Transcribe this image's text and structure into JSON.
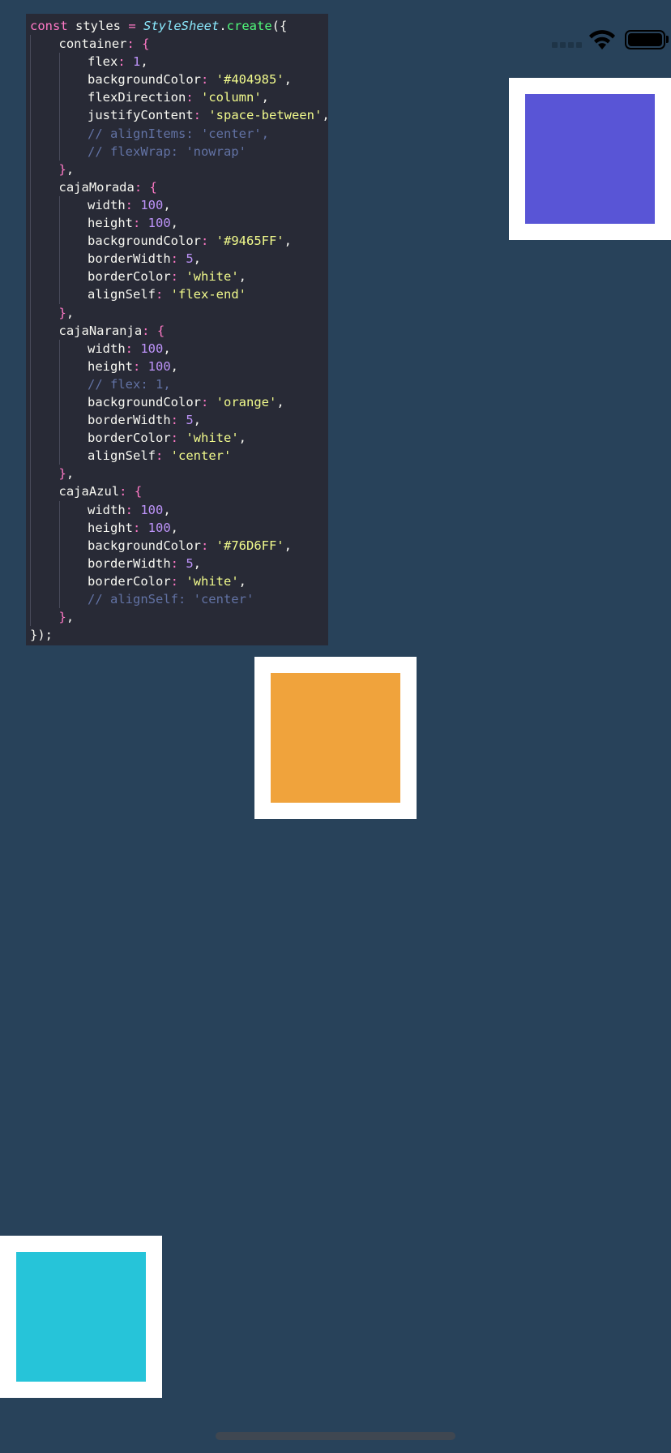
{
  "status_bar": {
    "signal_icon": "cellular-signal-icon",
    "wifi_icon": "wifi-icon",
    "battery_icon": "battery-icon"
  },
  "code": {
    "lines": [
      {
        "indent": 0,
        "tokens": [
          {
            "t": "const ",
            "c": "kw"
          },
          {
            "t": "styles ",
            "c": "ident"
          },
          {
            "t": "= ",
            "c": "op"
          },
          {
            "t": "StyleSheet",
            "c": "cls"
          },
          {
            "t": ".",
            "c": "ident"
          },
          {
            "t": "create",
            "c": "fn"
          },
          {
            "t": "({",
            "c": "ident"
          }
        ]
      },
      {
        "indent": 1,
        "tokens": [
          {
            "t": "container",
            "c": "ident"
          },
          {
            "t": ": ",
            "c": "op"
          },
          {
            "t": "{",
            "c": "br"
          }
        ]
      },
      {
        "indent": 2,
        "tokens": [
          {
            "t": "flex",
            "c": "ident"
          },
          {
            "t": ": ",
            "c": "op"
          },
          {
            "t": "1",
            "c": "nm"
          },
          {
            "t": ",",
            "c": "ident"
          }
        ]
      },
      {
        "indent": 2,
        "tokens": [
          {
            "t": "backgroundColor",
            "c": "ident"
          },
          {
            "t": ": ",
            "c": "op"
          },
          {
            "t": "'#404985'",
            "c": "str"
          },
          {
            "t": ",",
            "c": "ident"
          }
        ]
      },
      {
        "indent": 2,
        "tokens": [
          {
            "t": "flexDirection",
            "c": "ident"
          },
          {
            "t": ": ",
            "c": "op"
          },
          {
            "t": "'column'",
            "c": "str"
          },
          {
            "t": ",",
            "c": "ident"
          }
        ]
      },
      {
        "indent": 2,
        "tokens": [
          {
            "t": "justifyContent",
            "c": "ident"
          },
          {
            "t": ": ",
            "c": "op"
          },
          {
            "t": "'space-between'",
            "c": "str"
          },
          {
            "t": ",",
            "c": "ident"
          }
        ]
      },
      {
        "indent": 2,
        "tokens": [
          {
            "t": "// alignItems: 'center',",
            "c": "cmt"
          }
        ]
      },
      {
        "indent": 2,
        "tokens": [
          {
            "t": "// flexWrap: 'nowrap'",
            "c": "cmt"
          }
        ]
      },
      {
        "indent": 1,
        "tokens": [
          {
            "t": "}",
            "c": "br"
          },
          {
            "t": ",",
            "c": "ident"
          }
        ]
      },
      {
        "indent": 1,
        "tokens": [
          {
            "t": "cajaMorada",
            "c": "ident"
          },
          {
            "t": ": ",
            "c": "op"
          },
          {
            "t": "{",
            "c": "br"
          }
        ]
      },
      {
        "indent": 2,
        "tokens": [
          {
            "t": "width",
            "c": "ident"
          },
          {
            "t": ": ",
            "c": "op"
          },
          {
            "t": "100",
            "c": "nm"
          },
          {
            "t": ",",
            "c": "ident"
          }
        ]
      },
      {
        "indent": 2,
        "tokens": [
          {
            "t": "height",
            "c": "ident"
          },
          {
            "t": ": ",
            "c": "op"
          },
          {
            "t": "100",
            "c": "nm"
          },
          {
            "t": ",",
            "c": "ident"
          }
        ]
      },
      {
        "indent": 2,
        "tokens": [
          {
            "t": "backgroundColor",
            "c": "ident"
          },
          {
            "t": ": ",
            "c": "op"
          },
          {
            "t": "'#9465FF'",
            "c": "str"
          },
          {
            "t": ",",
            "c": "ident"
          }
        ]
      },
      {
        "indent": 2,
        "tokens": [
          {
            "t": "borderWidth",
            "c": "ident"
          },
          {
            "t": ": ",
            "c": "op"
          },
          {
            "t": "5",
            "c": "nm"
          },
          {
            "t": ",",
            "c": "ident"
          }
        ]
      },
      {
        "indent": 2,
        "tokens": [
          {
            "t": "borderColor",
            "c": "ident"
          },
          {
            "t": ": ",
            "c": "op"
          },
          {
            "t": "'white'",
            "c": "str"
          },
          {
            "t": ",",
            "c": "ident"
          }
        ]
      },
      {
        "indent": 2,
        "tokens": [
          {
            "t": "alignSelf",
            "c": "ident"
          },
          {
            "t": ": ",
            "c": "op"
          },
          {
            "t": "'flex-end'",
            "c": "str"
          }
        ]
      },
      {
        "indent": 1,
        "tokens": [
          {
            "t": "}",
            "c": "br"
          },
          {
            "t": ",",
            "c": "ident"
          }
        ]
      },
      {
        "indent": 1,
        "tokens": [
          {
            "t": "cajaNaranja",
            "c": "ident"
          },
          {
            "t": ": ",
            "c": "op"
          },
          {
            "t": "{",
            "c": "br"
          }
        ]
      },
      {
        "indent": 2,
        "tokens": [
          {
            "t": "width",
            "c": "ident"
          },
          {
            "t": ": ",
            "c": "op"
          },
          {
            "t": "100",
            "c": "nm"
          },
          {
            "t": ",",
            "c": "ident"
          }
        ]
      },
      {
        "indent": 2,
        "tokens": [
          {
            "t": "height",
            "c": "ident"
          },
          {
            "t": ": ",
            "c": "op"
          },
          {
            "t": "100",
            "c": "nm"
          },
          {
            "t": ",",
            "c": "ident"
          }
        ]
      },
      {
        "indent": 2,
        "tokens": [
          {
            "t": "// flex: 1,",
            "c": "cmt"
          }
        ]
      },
      {
        "indent": 2,
        "tokens": [
          {
            "t": "backgroundColor",
            "c": "ident"
          },
          {
            "t": ": ",
            "c": "op"
          },
          {
            "t": "'orange'",
            "c": "str"
          },
          {
            "t": ",",
            "c": "ident"
          }
        ]
      },
      {
        "indent": 2,
        "tokens": [
          {
            "t": "borderWidth",
            "c": "ident"
          },
          {
            "t": ": ",
            "c": "op"
          },
          {
            "t": "5",
            "c": "nm"
          },
          {
            "t": ",",
            "c": "ident"
          }
        ]
      },
      {
        "indent": 2,
        "tokens": [
          {
            "t": "borderColor",
            "c": "ident"
          },
          {
            "t": ": ",
            "c": "op"
          },
          {
            "t": "'white'",
            "c": "str"
          },
          {
            "t": ",",
            "c": "ident"
          }
        ]
      },
      {
        "indent": 2,
        "tokens": [
          {
            "t": "alignSelf",
            "c": "ident"
          },
          {
            "t": ": ",
            "c": "op"
          },
          {
            "t": "'center'",
            "c": "str"
          }
        ]
      },
      {
        "indent": 1,
        "tokens": [
          {
            "t": "}",
            "c": "br"
          },
          {
            "t": ",",
            "c": "ident"
          }
        ]
      },
      {
        "indent": 1,
        "tokens": [
          {
            "t": "cajaAzul",
            "c": "ident"
          },
          {
            "t": ": ",
            "c": "op"
          },
          {
            "t": "{",
            "c": "br"
          }
        ]
      },
      {
        "indent": 2,
        "tokens": [
          {
            "t": "width",
            "c": "ident"
          },
          {
            "t": ": ",
            "c": "op"
          },
          {
            "t": "100",
            "c": "nm"
          },
          {
            "t": ",",
            "c": "ident"
          }
        ]
      },
      {
        "indent": 2,
        "tokens": [
          {
            "t": "height",
            "c": "ident"
          },
          {
            "t": ": ",
            "c": "op"
          },
          {
            "t": "100",
            "c": "nm"
          },
          {
            "t": ",",
            "c": "ident"
          }
        ]
      },
      {
        "indent": 2,
        "tokens": [
          {
            "t": "backgroundColor",
            "c": "ident"
          },
          {
            "t": ": ",
            "c": "op"
          },
          {
            "t": "'#76D6FF'",
            "c": "str"
          },
          {
            "t": ",",
            "c": "ident"
          }
        ]
      },
      {
        "indent": 2,
        "tokens": [
          {
            "t": "borderWidth",
            "c": "ident"
          },
          {
            "t": ": ",
            "c": "op"
          },
          {
            "t": "5",
            "c": "nm"
          },
          {
            "t": ",",
            "c": "ident"
          }
        ]
      },
      {
        "indent": 2,
        "tokens": [
          {
            "t": "borderColor",
            "c": "ident"
          },
          {
            "t": ": ",
            "c": "op"
          },
          {
            "t": "'white'",
            "c": "str"
          },
          {
            "t": ",",
            "c": "ident"
          }
        ]
      },
      {
        "indent": 2,
        "tokens": [
          {
            "t": "// alignSelf: 'center'",
            "c": "cmt"
          }
        ]
      },
      {
        "indent": 1,
        "tokens": [
          {
            "t": "}",
            "c": "br"
          },
          {
            "t": ",",
            "c": "ident"
          }
        ]
      },
      {
        "indent": 0,
        "tokens": [
          {
            "t": "});",
            "c": "ident"
          }
        ]
      }
    ]
  },
  "app": {
    "background_color": "#28425a",
    "boxes": [
      {
        "id": "caja-morada",
        "border_color": "#ffffff",
        "fill_color": "#5955d6"
      },
      {
        "id": "caja-naranja",
        "border_color": "#ffffff",
        "fill_color": "#f0a33c"
      },
      {
        "id": "caja-azul",
        "border_color": "#ffffff",
        "fill_color": "#26c4d9"
      }
    ]
  }
}
